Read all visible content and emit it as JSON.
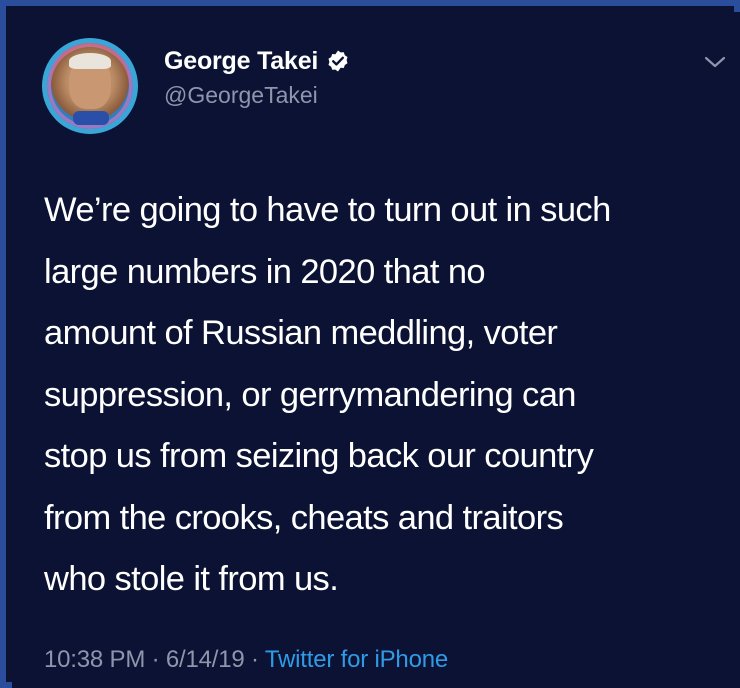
{
  "tweet": {
    "author": {
      "display_name": "George Takei",
      "handle": "@GeorgeTakei",
      "verified": true,
      "avatar_icon": "profile-photo"
    },
    "text_lines": [
      "We’re going to have to turn out in such",
      "large numbers in 2020 that no",
      "amount of Russian meddling, voter",
      "suppression, or gerrymandering can",
      "stop us from seizing back our country",
      "from the crooks, cheats and traitors",
      "who stole it from us."
    ],
    "meta": {
      "time": "10:38 PM",
      "separator": "·",
      "date": "6/14/19",
      "source": "Twitter for iPhone"
    }
  },
  "colors": {
    "background": "#0b1233",
    "border": "#2a4d9c",
    "text": "#ffffff",
    "muted": "#8c97ad",
    "accent": "#2f9be6"
  }
}
